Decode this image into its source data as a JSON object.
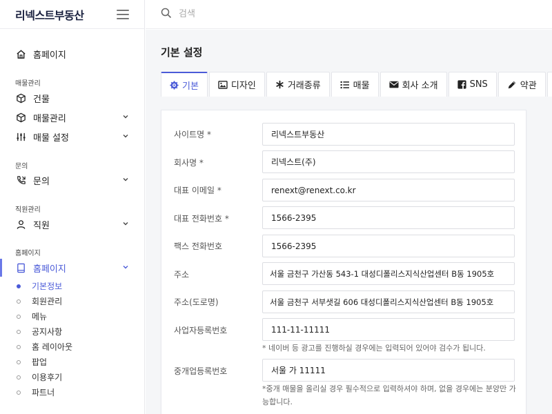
{
  "brand": "리넥스트부동산",
  "search": {
    "placeholder": "검색"
  },
  "sidebar": {
    "home": "홈페이지",
    "sections": [
      {
        "label": "매물관리"
      },
      {
        "label": "문의"
      },
      {
        "label": "직원관리"
      },
      {
        "label": "홈페이지"
      }
    ],
    "items": [
      {
        "label": "건물"
      },
      {
        "label": "매물관리"
      },
      {
        "label": "매물 설정"
      },
      {
        "label": "문의"
      },
      {
        "label": "직원"
      },
      {
        "label": "홈페이지"
      }
    ],
    "sub_items": [
      {
        "label": "기본정보"
      },
      {
        "label": "회원관리"
      },
      {
        "label": "메뉴"
      },
      {
        "label": "공지사항"
      },
      {
        "label": "홈 레이아웃"
      },
      {
        "label": "팝업"
      },
      {
        "label": "이용후기"
      },
      {
        "label": "파트너"
      }
    ]
  },
  "page": {
    "title": "기본 설정"
  },
  "tabs": [
    {
      "label": "기본",
      "icon": "gear-icon"
    },
    {
      "label": "디자인",
      "icon": "image-icon"
    },
    {
      "label": "거래종류",
      "icon": "asterisk-icon"
    },
    {
      "label": "매물",
      "icon": "list-icon"
    },
    {
      "label": "회사 소개",
      "icon": "envelope-icon"
    },
    {
      "label": "SNS",
      "icon": "facebook-icon"
    },
    {
      "label": "약관",
      "icon": "pen-icon"
    }
  ],
  "form": {
    "site_name": {
      "label": "사이트명 *",
      "value": "리넥스트부동산"
    },
    "company_name": {
      "label": "회사명 *",
      "value": "리넥스트(주)"
    },
    "email": {
      "label": "대표 이메일 *",
      "value": "renext@renext.co.kr"
    },
    "phone": {
      "label": "대표 전화번호 *",
      "value": "1566-2395"
    },
    "fax": {
      "label": "팩스 전화번호",
      "value": "1566-2395"
    },
    "address": {
      "label": "주소",
      "value": "서울 금천구 가산동 543-1 대성디폴리스지식산업센터 B동 1905호"
    },
    "road_address": {
      "label": "주소(도로명)",
      "value": "서울 금천구 서부샛길 606 대성디폴리스지식산업센터 B동 1905호"
    },
    "biz_number": {
      "label": "사업자등록번호",
      "value": "111-11-11111",
      "hint": "* 네이버 등 광고를 진행하실 경우에는 입력되어 있어야 검수가 됩니다."
    },
    "broker_number": {
      "label": "중개업등록번호",
      "value": "서울 가 11111",
      "hint": "*중개 매물을 올리실 경우 필수적으로 입력하셔야 하며, 없을 경우에는 분양만 가능합니다."
    }
  },
  "colors": {
    "accent": "#4a5ad8",
    "brand": "#1b2240"
  }
}
